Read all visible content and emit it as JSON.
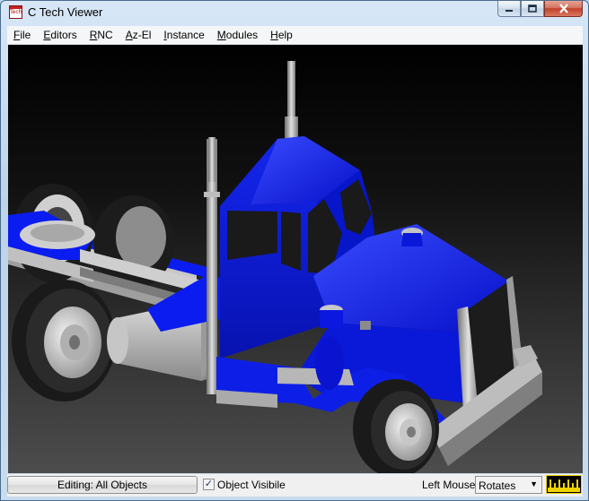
{
  "window": {
    "title": "C Tech Viewer",
    "app_icon_text": "Tech"
  },
  "menu": [
    {
      "pre": "",
      "u": "F",
      "post": "ile"
    },
    {
      "pre": "",
      "u": "E",
      "post": "ditors"
    },
    {
      "pre": "",
      "u": "R",
      "post": "NC"
    },
    {
      "pre": "",
      "u": "A",
      "post": "z-El"
    },
    {
      "pre": "",
      "u": "I",
      "post": "nstance"
    },
    {
      "pre": "",
      "u": "M",
      "post": "odules"
    },
    {
      "pre": "",
      "u": "H",
      "post": "elp"
    }
  ],
  "status": {
    "editing_label": "Editing: All Objects",
    "object_visible_label": "Object Visibile",
    "object_visible_checked": true,
    "mouse_label": "Left Mouse",
    "mouse_mode": "Rotates"
  },
  "colors": {
    "truck_body": "#0a1cf0",
    "chrome": "#b9b9b9",
    "tire": "#1f1f1f"
  }
}
